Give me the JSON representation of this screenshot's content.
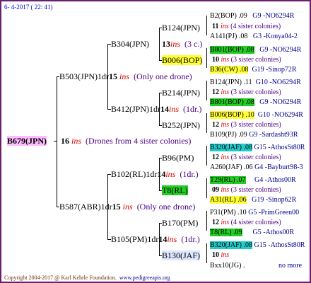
{
  "header": {
    "date": "6- 4-2017 ( 22: 41)"
  },
  "footer": {
    "copyright": "Copyright 2004-2017 @ Karl Kehrle Foundation.",
    "site": "www.pedigreeapis.org"
  },
  "root": {
    "name": "B679(JPN)",
    "num": "16",
    "ins": "ins",
    "note": "(Drones from 4 sister colonies)"
  },
  "gen1": {
    "a": {
      "name": "B503(JPN)1dr",
      "num": "15",
      "ins": "ins",
      "note": "(Only one drone)"
    },
    "b": {
      "name": "B587(ABR)1dr",
      "num": "15",
      "ins": "ins",
      "note": "(Only one drone)"
    }
  },
  "gen2": {
    "a": {
      "name": "B304(JPN)",
      "num": "13",
      "ins": "ins",
      "note": "(3 c.)"
    },
    "b": {
      "name": "B412(JPN)1dr",
      "num": "14",
      "ins": "ins",
      "note": "(1dr.)"
    },
    "c": {
      "name": "B102(RL)1dr",
      "num": "14",
      "ins": "ins",
      "note": "(1dr.)"
    },
    "d": {
      "name": "B105(PM)1dr",
      "num": "14",
      "ins": "ins",
      "note": "(1dr.)"
    }
  },
  "gen3": {
    "a": {
      "name": "B124(JPN)",
      "num": "11",
      "ins": "ins",
      "note": "(4 sister colonies)"
    },
    "b": {
      "name": "B006(BOP)",
      "num": "10",
      "ins": "ins",
      "note": "(3 sister colonies)"
    },
    "c": {
      "name": "B214(JPN)",
      "num": "12",
      "ins": "ins",
      "note": "(3 sister colonies)"
    },
    "d": {
      "name": "B252(JPN)",
      "num": "12",
      "ins": "ins",
      "note": "(3 sister colonies)"
    },
    "e": {
      "name": "B96(PM)",
      "num": "12",
      "ins": "ins",
      "note": "(3 sister colonies)"
    },
    "f": {
      "name": "T8(RL)",
      "num": "09",
      "ins": "ins",
      "note": "(3 sister colonies)"
    },
    "g": {
      "name": "B170(PM)",
      "num": "12",
      "ins": "ins",
      "note": "(4 sister colonies)"
    },
    "h": {
      "name": "B130(JAF)",
      "num": "10",
      "ins": "ins",
      "note": ""
    }
  },
  "gen4": [
    {
      "name": "B2(BOP) .09",
      "code": "G9 -NO6294R"
    },
    {
      "name": "A141(PJ) .08",
      "code": "G3 -Konya04-2"
    },
    {
      "name": "B801(BOP) .08",
      "code": "G9 -NO6294R"
    },
    {
      "name": "B36(CW) .08",
      "code": "G19 -Sinop72R"
    },
    {
      "name": "B124(JPN) .11",
      "code": "G10 -NO6294R"
    },
    {
      "name": "B801(BOP) .08",
      "code": "G9 -NO6294R"
    },
    {
      "name": "B006(BOP) .10",
      "code": "G10 -NO6294R"
    },
    {
      "name": "B109(PJ) .09",
      "code": "G9 -Sardasht93R"
    },
    {
      "name": "B320(JAF) .08",
      "code": "G15 -AthosSt80R"
    },
    {
      "name": "A260(JAF) .06",
      "code": "G4 -Bayburt98-3"
    },
    {
      "name": "T29(RL) .07",
      "code": "G4 -Athos00R"
    },
    {
      "name": "A31(RL) .06",
      "code": "G19 -Sinop62R"
    },
    {
      "name": "P31(PM) .10",
      "code": "G5 -PrimGreen00"
    },
    {
      "name": "T8(RL) .09",
      "code": "G5 -Athos00R"
    },
    {
      "name": "B320(JAF) .08",
      "code": "G15 -AthosSt80R"
    },
    {
      "name": "Bxx10(JG) .",
      "code": "no more"
    }
  ],
  "colors": {
    "frame": "#6b1e6b",
    "yellow": "#ffff33",
    "green": "#22cc22",
    "cyan": "#22cccc",
    "pink": "#ffbbff"
  }
}
